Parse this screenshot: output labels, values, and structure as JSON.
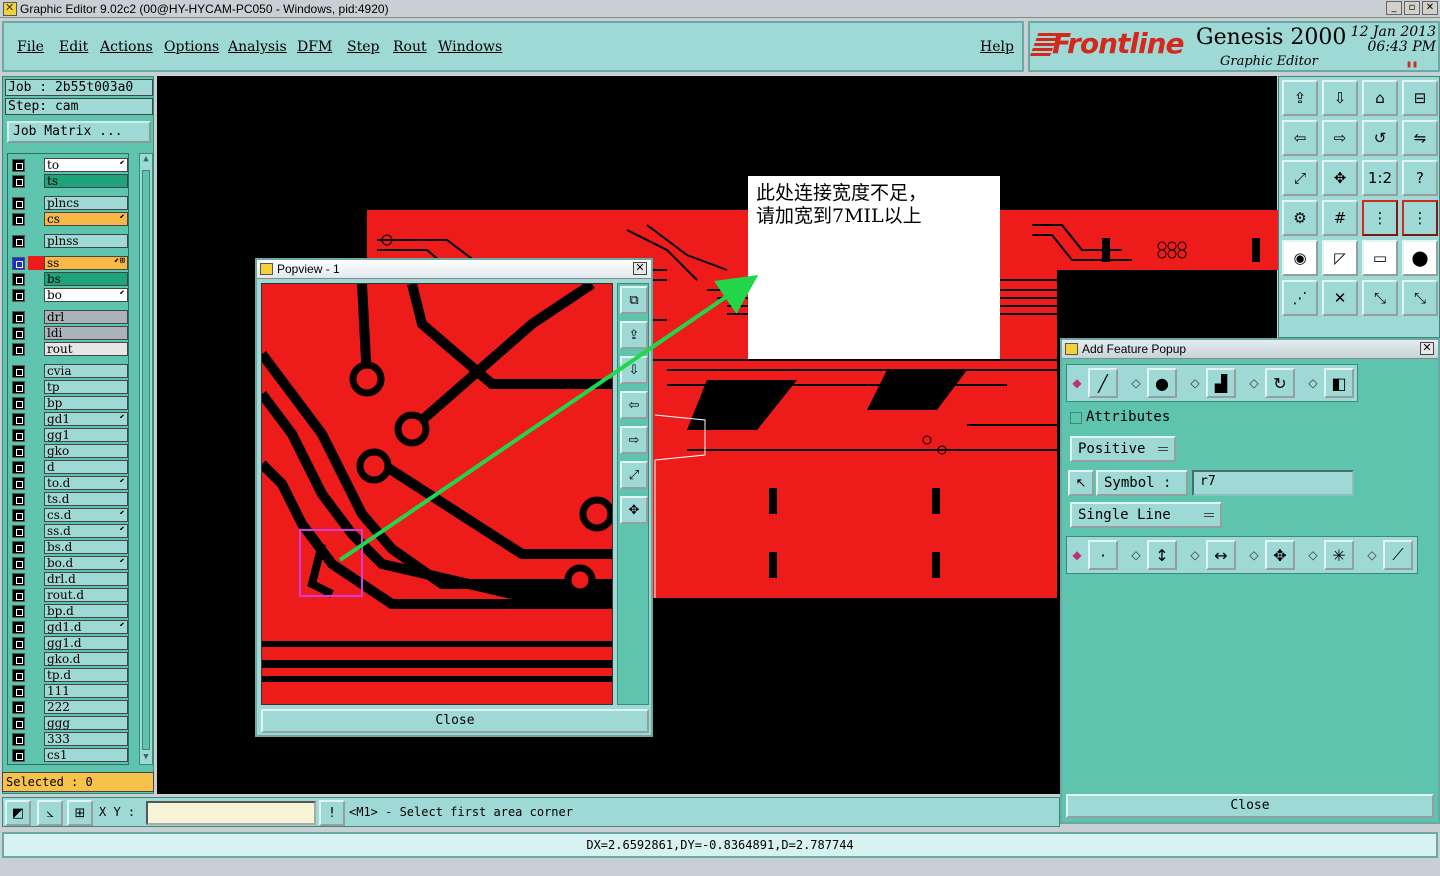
{
  "window": {
    "title": "Graphic Editor 9.02c2 (00@HY-HYCAM-PC050 - Windows, pid:4920)",
    "buttons": [
      "_",
      "▫",
      "✕"
    ]
  },
  "menu": {
    "items": [
      "File",
      "Edit",
      "Actions",
      "Options",
      "Analysis",
      "DFM",
      "Step",
      "Rout",
      "Windows"
    ],
    "help": "Help"
  },
  "branding": {
    "logo": "Frontline",
    "product": "Genesis 2000",
    "subtitle": "Graphic Editor",
    "date_line1": "12 Jan 2013",
    "date_line2": "06:43 PM"
  },
  "job": {
    "job_label": "Job : 2b55t003a0",
    "step_label": "Step: cam",
    "matrix_button": "Job Matrix ..."
  },
  "layers": [
    {
      "name": "to",
      "color": "#ffffff",
      "flag": "⬋",
      "swatch": ""
    },
    {
      "name": "ts",
      "color": "#1fa37a",
      "flag": "",
      "swatch": ""
    },
    {
      "name": "plncs",
      "color": "#9fd9d5",
      "flag": "",
      "swatch": ""
    },
    {
      "name": "cs",
      "color": "#f7b845",
      "flag": "⬋",
      "swatch": ""
    },
    {
      "name": "plnss",
      "color": "#9fd9d5",
      "flag": "",
      "swatch": ""
    },
    {
      "name": "ss",
      "color": "#f7b845",
      "flag": "⬋⊞",
      "swatch": "#ee1b1b",
      "active": true
    },
    {
      "name": "bs",
      "color": "#1fa37a",
      "flag": "",
      "swatch": ""
    },
    {
      "name": "bo",
      "color": "#ffffff",
      "flag": "⬋",
      "swatch": ""
    },
    {
      "name": "drl",
      "color": "#aab4b8",
      "flag": "",
      "swatch": ""
    },
    {
      "name": "ldi",
      "color": "#aab4b8",
      "flag": "",
      "swatch": ""
    },
    {
      "name": "rout",
      "color": "#e6e6e6",
      "flag": "",
      "swatch": ""
    },
    {
      "name": "cvia",
      "color": "#9fd9d5",
      "flag": "",
      "swatch": ""
    },
    {
      "name": "tp",
      "color": "#9fd9d5",
      "flag": "",
      "swatch": ""
    },
    {
      "name": "bp",
      "color": "#9fd9d5",
      "flag": "",
      "swatch": ""
    },
    {
      "name": "gd1",
      "color": "#9fd9d5",
      "flag": "⬋",
      "swatch": ""
    },
    {
      "name": "gg1",
      "color": "#9fd9d5",
      "flag": "",
      "swatch": ""
    },
    {
      "name": "gko",
      "color": "#9fd9d5",
      "flag": "",
      "swatch": ""
    },
    {
      "name": "d",
      "color": "#9fd9d5",
      "flag": "",
      "swatch": ""
    },
    {
      "name": "to.d",
      "color": "#9fd9d5",
      "flag": "⬋",
      "swatch": ""
    },
    {
      "name": "ts.d",
      "color": "#9fd9d5",
      "flag": "",
      "swatch": ""
    },
    {
      "name": "cs.d",
      "color": "#9fd9d5",
      "flag": "⬋",
      "swatch": ""
    },
    {
      "name": "ss.d",
      "color": "#9fd9d5",
      "flag": "⬋",
      "swatch": ""
    },
    {
      "name": "bs.d",
      "color": "#9fd9d5",
      "flag": "",
      "swatch": ""
    },
    {
      "name": "bo.d",
      "color": "#9fd9d5",
      "flag": "⬋",
      "swatch": ""
    },
    {
      "name": "drl.d",
      "color": "#9fd9d5",
      "flag": "",
      "swatch": ""
    },
    {
      "name": "rout.d",
      "color": "#9fd9d5",
      "flag": "",
      "swatch": ""
    },
    {
      "name": "bp.d",
      "color": "#9fd9d5",
      "flag": "",
      "swatch": ""
    },
    {
      "name": "gd1.d",
      "color": "#9fd9d5",
      "flag": "⬋",
      "swatch": ""
    },
    {
      "name": "gg1.d",
      "color": "#9fd9d5",
      "flag": "",
      "swatch": ""
    },
    {
      "name": "gko.d",
      "color": "#9fd9d5",
      "flag": "",
      "swatch": ""
    },
    {
      "name": "tp.d",
      "color": "#9fd9d5",
      "flag": "",
      "swatch": ""
    },
    {
      "name": "111",
      "color": "#9fd9d5",
      "flag": "",
      "swatch": ""
    },
    {
      "name": "222",
      "color": "#9fd9d5",
      "flag": "",
      "swatch": ""
    },
    {
      "name": "ggg",
      "color": "#9fd9d5",
      "flag": "",
      "swatch": ""
    },
    {
      "name": "333",
      "color": "#9fd9d5",
      "flag": "",
      "swatch": ""
    },
    {
      "name": "cs1",
      "color": "#9fd9d5",
      "flag": "",
      "swatch": ""
    }
  ],
  "selected_label": "Selected : 0",
  "note": {
    "line1": "此处连接宽度不足，",
    "line2": "请加宽到7MIL以上"
  },
  "popview": {
    "title": "Popview - 1",
    "close": "Close"
  },
  "add_feature": {
    "title": "Add Feature Popup",
    "attributes_label": "Attributes",
    "polarity": "Positive",
    "symbol_label": "Symbol :",
    "symbol_value": "r7",
    "mode": "Single Line",
    "close": "Close"
  },
  "command": {
    "xy_label": "X Y :",
    "xy_value": "",
    "info_icon": "!",
    "prompt": "<M1> - Select first area corner"
  },
  "status": "DX=2.6592861,DY=-0.8364891,D=2.787744",
  "tool_glyphs": {
    "r1": [
      "⇪",
      "⇩",
      "⌂",
      "⊟"
    ],
    "r2": [
      "⇦",
      "⇨",
      "↺",
      "⇋"
    ],
    "r3": [
      "⤢",
      "✥",
      "1:2",
      "?"
    ],
    "r4": [
      "⚙",
      "#",
      "⋮",
      "⋮"
    ],
    "r5": [
      "◉",
      "◸",
      "▭",
      "⬤"
    ],
    "r6": [
      "⋰",
      "✕",
      "⤡",
      "⤡"
    ],
    "pop": [
      "⧉",
      "⇪",
      "⇩",
      "⇦",
      "⇨",
      "⤢",
      "✥"
    ],
    "feat_row1": [
      "╱",
      "●",
      "▟",
      "↻",
      "◧"
    ],
    "feat_row2": [
      "·",
      "↕",
      "↔",
      "✥",
      "✳",
      "⟋"
    ]
  }
}
